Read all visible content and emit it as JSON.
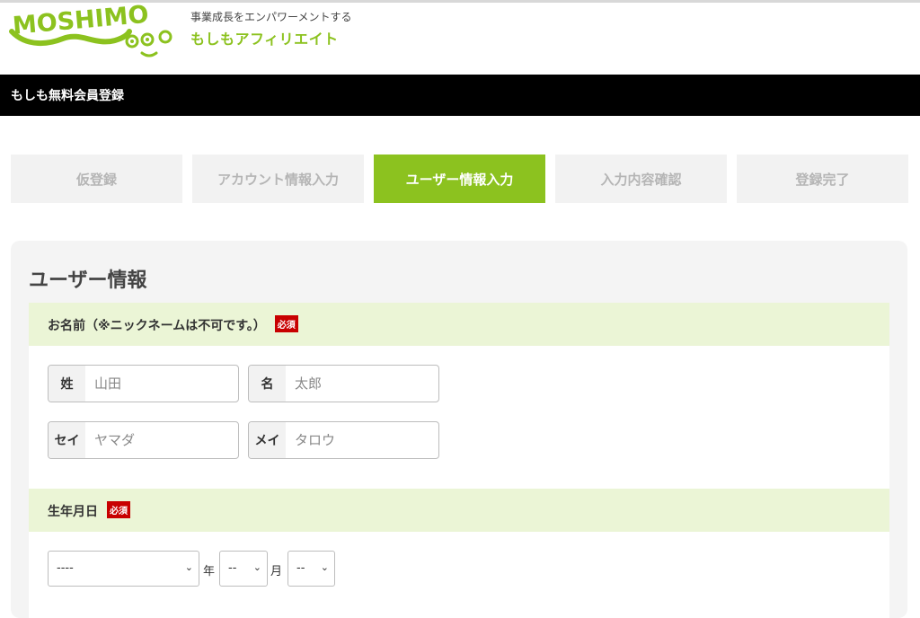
{
  "header": {
    "logo_text": "MOSHIMO",
    "tagline": "事業成長をエンパワーメントする",
    "brand": "もしもアフィリエイト"
  },
  "pagebar": {
    "title": "もしも無料会員登録"
  },
  "steps": [
    {
      "label": "仮登録",
      "active": false
    },
    {
      "label": "アカウント情報入力",
      "active": false
    },
    {
      "label": "ユーザー情報入力",
      "active": true
    },
    {
      "label": "入力内容確認",
      "active": false
    },
    {
      "label": "登録完了",
      "active": false
    }
  ],
  "form": {
    "title": "ユーザー情報",
    "required_badge": "必須",
    "name_section": {
      "label": "お名前（※ニックネームは不可です。）",
      "last_name": {
        "tag": "姓",
        "placeholder": "山田"
      },
      "first_name": {
        "tag": "名",
        "placeholder": "太郎"
      },
      "last_kana": {
        "tag": "セイ",
        "placeholder": "ヤマダ"
      },
      "first_kana": {
        "tag": "メイ",
        "placeholder": "タロウ"
      }
    },
    "birth_section": {
      "label": "生年月日",
      "year_value": "----",
      "year_unit": "年",
      "month_value": "--",
      "month_unit": "月",
      "day_value": "--"
    }
  },
  "colors": {
    "accent": "#8cc21f",
    "section_bg": "#ebf5d6",
    "required": "#c80000",
    "pagebar": "#000000"
  }
}
